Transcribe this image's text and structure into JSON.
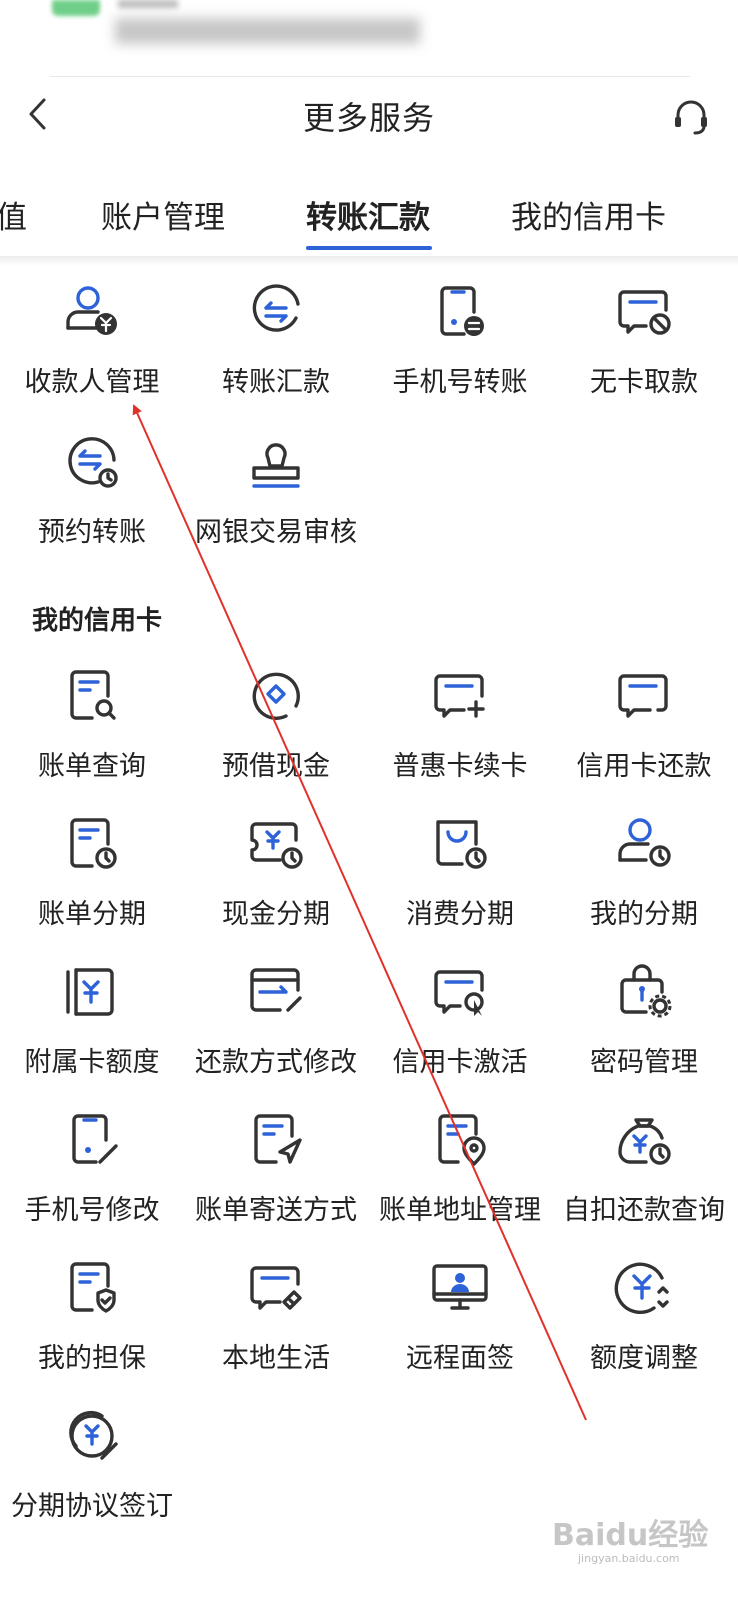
{
  "header": {
    "title": "更多服务"
  },
  "tabs": [
    {
      "label": "值"
    },
    {
      "label": "账户管理"
    },
    {
      "label": "转账汇款",
      "active": true
    },
    {
      "label": "我的信用卡"
    }
  ],
  "transfer": {
    "items": [
      {
        "label": "收款人管理",
        "icon": "payee-icon"
      },
      {
        "label": "转账汇款",
        "icon": "transfer-icon"
      },
      {
        "label": "手机号转账",
        "icon": "phone-transfer-icon"
      },
      {
        "label": "无卡取款",
        "icon": "cardless-withdraw-icon"
      },
      {
        "label": "预约转账",
        "icon": "scheduled-transfer-icon"
      },
      {
        "label": "网银交易审核",
        "icon": "stamp-icon"
      }
    ]
  },
  "credit": {
    "title": "我的信用卡",
    "items": [
      {
        "label": "账单查询",
        "icon": "bill-search-icon"
      },
      {
        "label": "预借现金",
        "icon": "cash-advance-icon"
      },
      {
        "label": "普惠卡续卡",
        "icon": "card-renew-icon"
      },
      {
        "label": "信用卡还款",
        "icon": "card-repay-icon"
      },
      {
        "label": "账单分期",
        "icon": "bill-installment-icon"
      },
      {
        "label": "现金分期",
        "icon": "cash-installment-icon"
      },
      {
        "label": "消费分期",
        "icon": "shopping-installment-icon"
      },
      {
        "label": "我的分期",
        "icon": "my-installment-icon"
      },
      {
        "label": "附属卡额度",
        "icon": "supplementary-card-icon"
      },
      {
        "label": "还款方式修改",
        "icon": "repay-method-icon"
      },
      {
        "label": "信用卡激活",
        "icon": "card-activate-icon"
      },
      {
        "label": "密码管理",
        "icon": "password-icon"
      },
      {
        "label": "手机号修改",
        "icon": "phone-edit-icon"
      },
      {
        "label": "账单寄送方式",
        "icon": "bill-delivery-icon"
      },
      {
        "label": "账单地址管理",
        "icon": "bill-address-icon"
      },
      {
        "label": "自扣还款查询",
        "icon": "auto-repay-icon"
      },
      {
        "label": "我的担保",
        "icon": "guarantee-icon"
      },
      {
        "label": "本地生活",
        "icon": "local-life-icon"
      },
      {
        "label": "远程面签",
        "icon": "remote-sign-icon"
      },
      {
        "label": "额度调整",
        "icon": "limit-adjust-icon"
      },
      {
        "label": "分期协议签订",
        "icon": "installment-agreement-icon"
      }
    ]
  },
  "watermark": {
    "text": "Baidu经验",
    "sub": "jingyan.baidu.com"
  },
  "colors": {
    "accent": "#2d62d8",
    "icon": "#333333",
    "arrow": "#e0312a"
  }
}
